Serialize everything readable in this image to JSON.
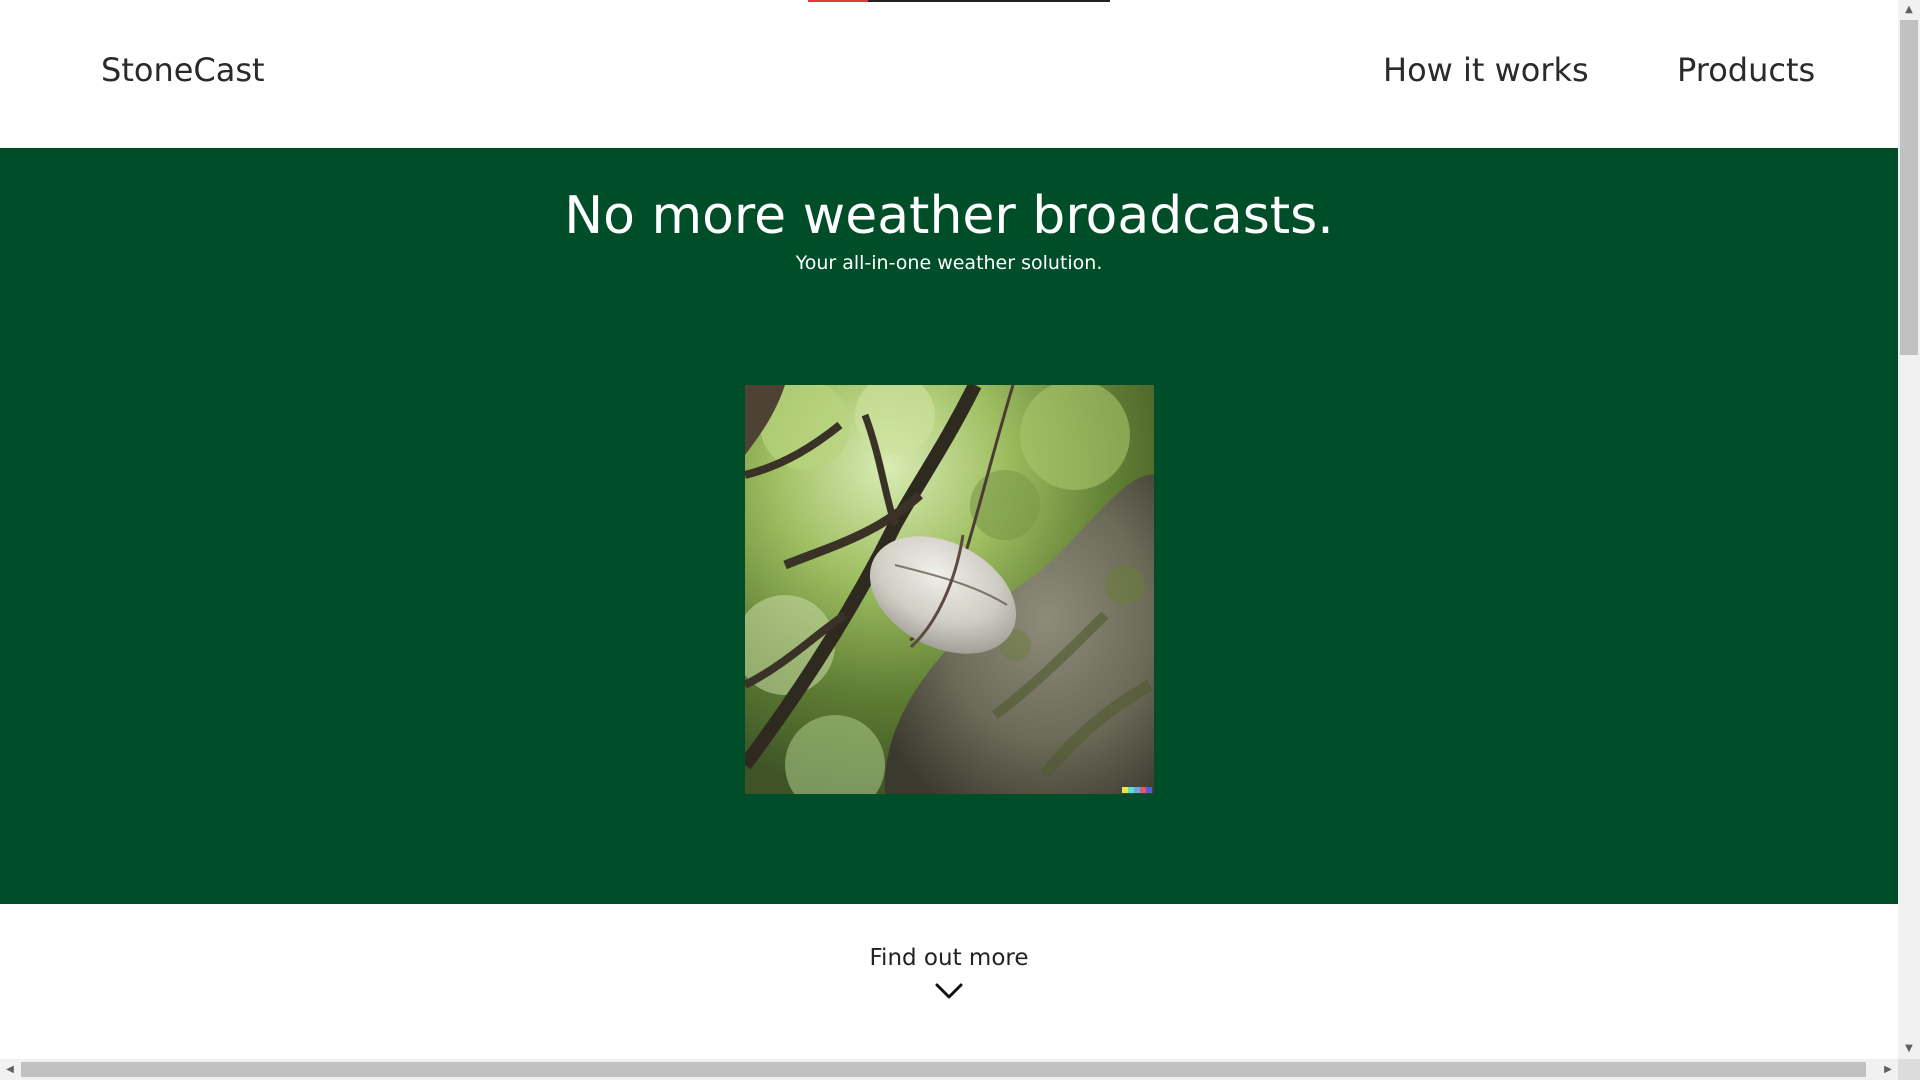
{
  "header": {
    "brand": "StoneCast",
    "nav": [
      {
        "label": "How it works"
      },
      {
        "label": "Products"
      }
    ],
    "reading_progress": 0.2
  },
  "hero": {
    "title": "No more weather broadcasts.",
    "subtitle": "Your all-in-one weather solution.",
    "image": {
      "subject": "stone hanging from a string in a tree",
      "icon": "photo-image"
    }
  },
  "cta": {
    "label": "Find out more",
    "icon": "chevron-down-icon"
  },
  "colors": {
    "hero_background": "#004d2a",
    "progress_accent": "#e03a3a",
    "text": "#222222"
  },
  "scrollbars": {
    "vertical_up_glyph": "▲",
    "vertical_down_glyph": "▼",
    "horizontal_left_glyph": "◀",
    "horizontal_right_glyph": "▶"
  }
}
